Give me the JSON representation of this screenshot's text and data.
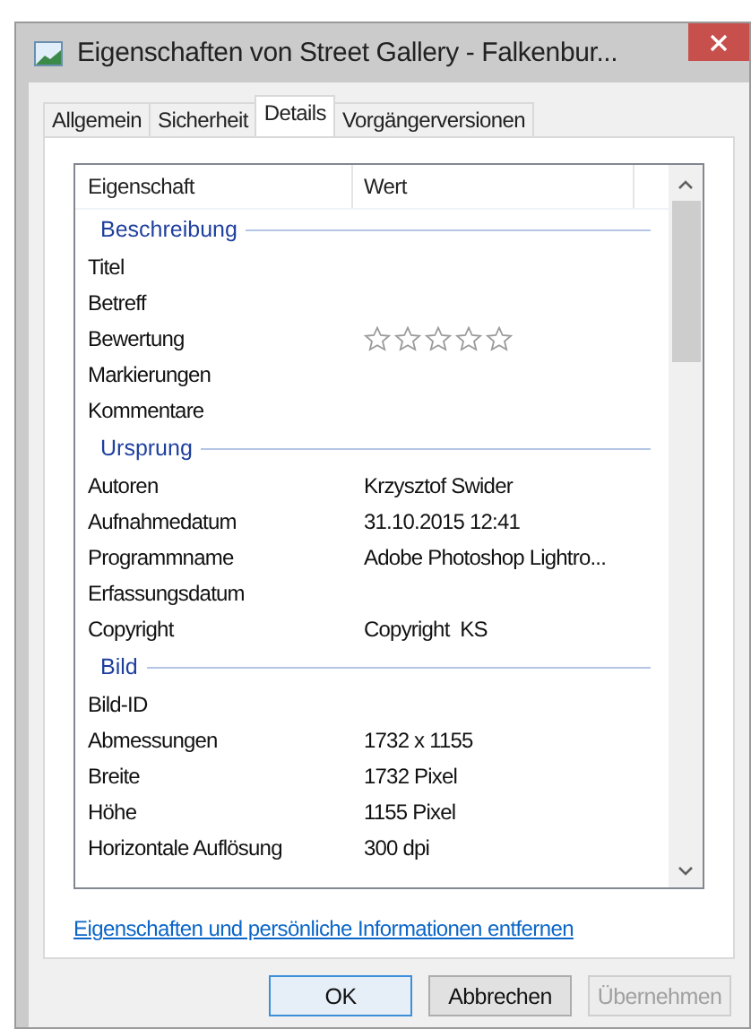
{
  "window": {
    "title": "Eigenschaften von Street Gallery - Falkenbur..."
  },
  "tabs": [
    {
      "label": "Allgemein",
      "selected": false
    },
    {
      "label": "Sicherheit",
      "selected": false
    },
    {
      "label": "Details",
      "selected": true
    },
    {
      "label": "Vorgängerversionen",
      "selected": false
    }
  ],
  "table": {
    "columns": [
      "Eigenschaft",
      "Wert"
    ],
    "groups": [
      {
        "name": "Beschreibung",
        "rows": [
          {
            "kind": "text",
            "property": "Titel"
          },
          {
            "kind": "text",
            "property": "Betreff"
          },
          {
            "kind": "rating",
            "property": "Bewertung",
            "stars": 0
          },
          {
            "kind": "text",
            "property": "Markierungen"
          },
          {
            "kind": "text",
            "property": "Kommentare"
          }
        ]
      },
      {
        "name": "Ursprung",
        "rows": [
          {
            "kind": "text",
            "property": "Autoren",
            "value": "Krzysztof Swider"
          },
          {
            "kind": "text",
            "property": "Aufnahmedatum",
            "value": "31.10.2015 12:41"
          },
          {
            "kind": "text",
            "property": "Programmname",
            "value": "Adobe Photoshop Lightro..."
          },
          {
            "kind": "text",
            "property": "Erfassungsdatum"
          },
          {
            "kind": "text",
            "property": "Copyright",
            "value": "Copyright  KS"
          }
        ]
      },
      {
        "name": "Bild",
        "rows": [
          {
            "kind": "text",
            "property": "Bild-ID"
          },
          {
            "kind": "text",
            "property": "Abmessungen",
            "value": "1732 x 1155"
          },
          {
            "kind": "text",
            "property": "Breite",
            "value": "1732 Pixel"
          },
          {
            "kind": "text",
            "property": "Höhe",
            "value": "1155 Pixel"
          },
          {
            "kind": "text",
            "property": "Horizontale Auflösung",
            "value": "300 dpi"
          }
        ]
      }
    ]
  },
  "link": "Eigenschaften und persönliche Informationen entfernen",
  "buttons": [
    {
      "label": "OK",
      "disabled": false,
      "default": true
    },
    {
      "label": "Abbrechen",
      "disabled": false,
      "default": false
    },
    {
      "label": "Übernehmen",
      "disabled": true,
      "default": false
    }
  ]
}
